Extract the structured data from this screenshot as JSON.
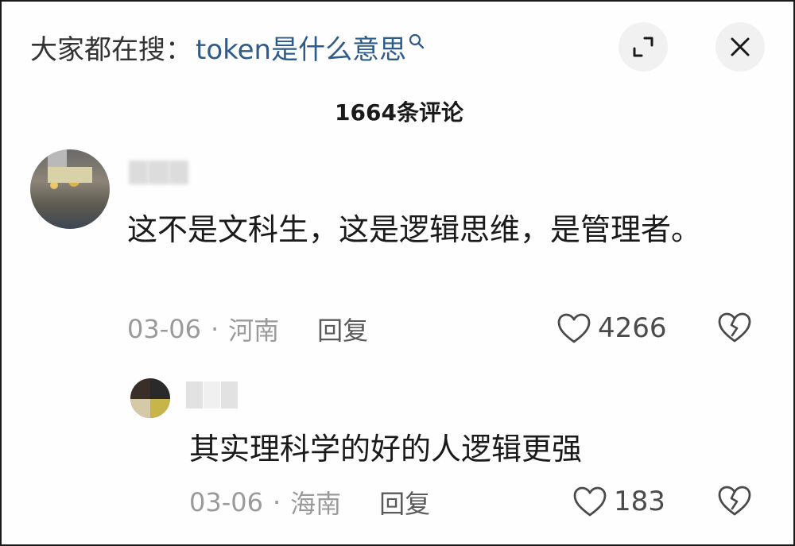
{
  "search": {
    "prefix": "大家都在搜：",
    "query": "token是什么意思"
  },
  "header": {
    "comment_count": "1664条评论"
  },
  "comments": [
    {
      "text": "这不是文科生，这是逻辑思维，是管理者。",
      "date": "03-06",
      "separator": "·",
      "location": "河南",
      "reply_label": "回复",
      "likes": "4266"
    },
    {
      "text": "其实理科学的好的人逻辑更强",
      "date": "03-06",
      "separator": "·",
      "location": "海南",
      "reply_label": "回复",
      "likes": "183"
    }
  ],
  "icons": {
    "expand": "expand-icon",
    "close": "close-icon",
    "like": "heart-icon",
    "dislike": "broken-heart-icon",
    "search": "search-icon"
  },
  "colors": {
    "query_link": "#2c5b8c",
    "meta_text": "#9a9a9a",
    "button_bg": "#f1f1f1"
  }
}
